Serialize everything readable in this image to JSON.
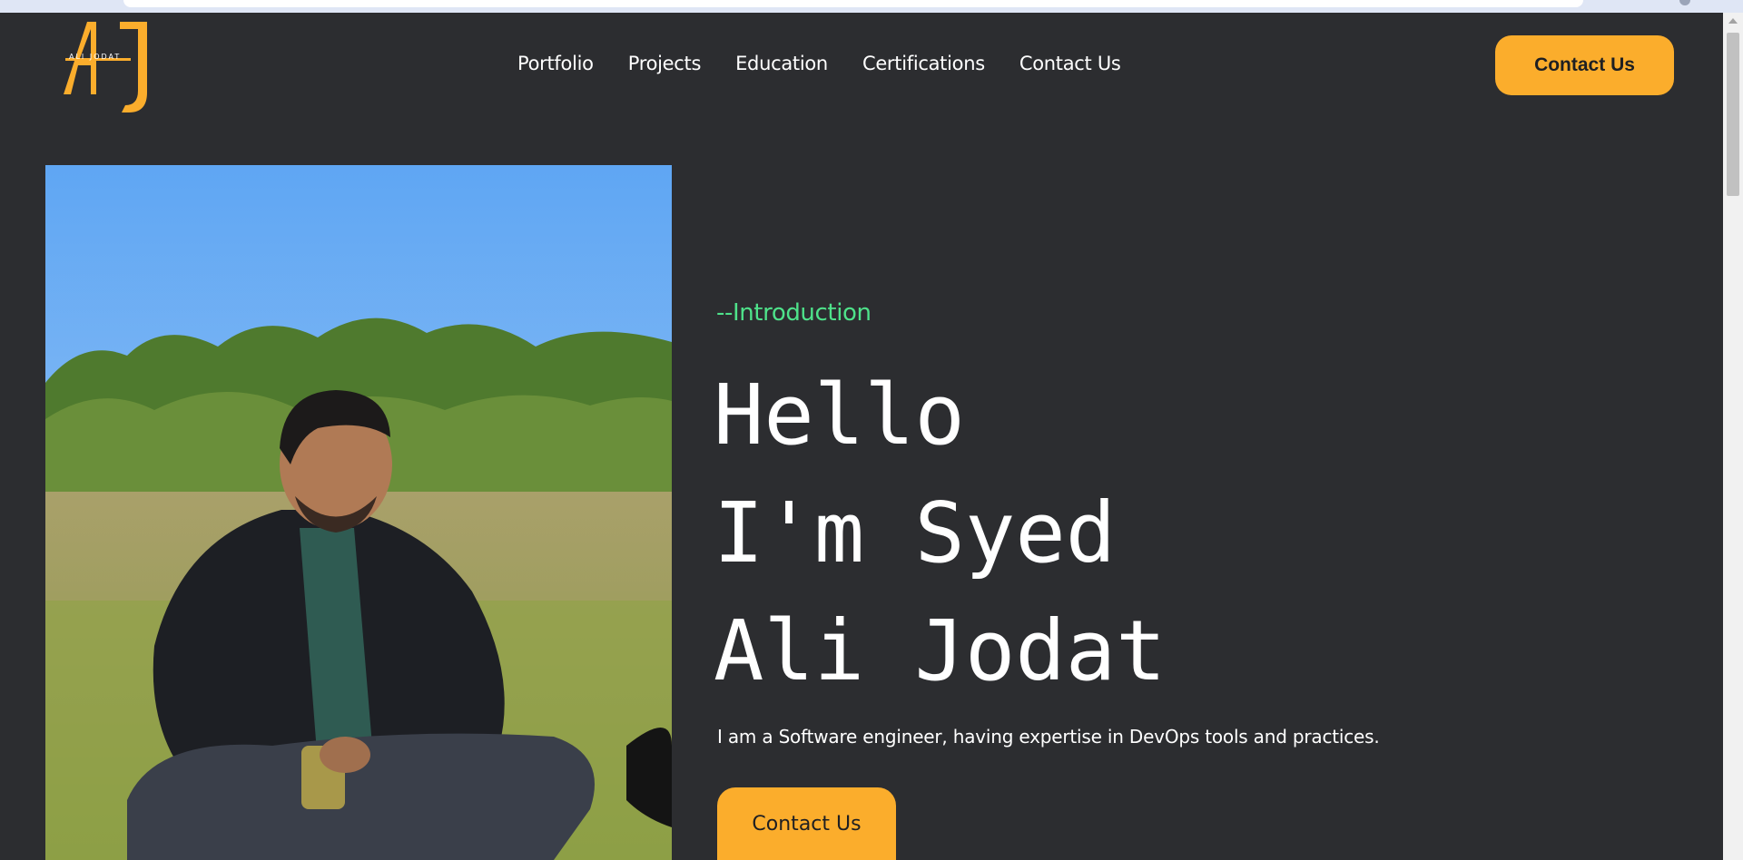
{
  "logo": {
    "monogram": "AJ",
    "name": "ALI JODAT"
  },
  "nav": {
    "items": [
      {
        "label": "Portfolio"
      },
      {
        "label": "Projects"
      },
      {
        "label": "Education"
      },
      {
        "label": "Certifications"
      },
      {
        "label": "Contact Us"
      }
    ]
  },
  "header": {
    "cta_label": "Contact Us"
  },
  "hero": {
    "intro_label": "--Introduction",
    "title_lines": [
      "Hello",
      "I'm Syed",
      "Ali Jodat"
    ],
    "description": "I am a Software engineer, having expertise in DevOps tools and practices.",
    "cta_label": "Contact Us"
  },
  "colors": {
    "background": "#2c2d30",
    "accent": "#fbad2c",
    "intro_green": "#4ee28a",
    "text": "#ffffff"
  },
  "icons": {
    "logo": "aj-monogram-logo"
  }
}
